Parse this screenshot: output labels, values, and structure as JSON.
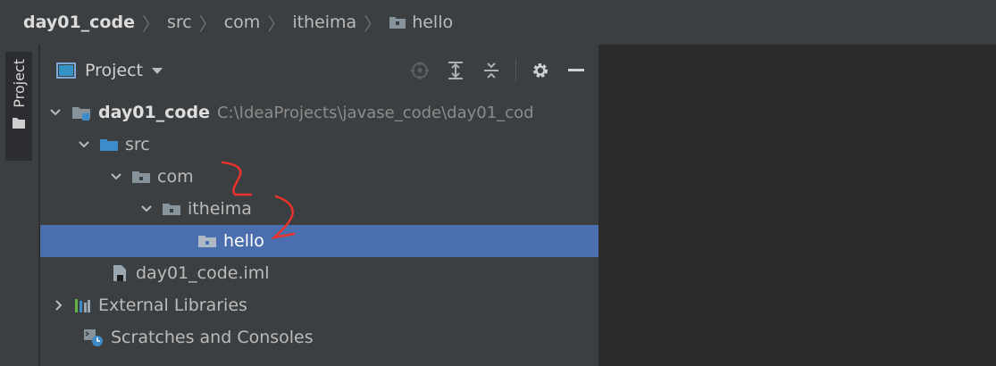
{
  "breadcrumb": {
    "items": [
      "day01_code",
      "src",
      "com",
      "itheima",
      "hello"
    ]
  },
  "toolstrip": {
    "project_tab_label": "Project"
  },
  "panel": {
    "title": "Project",
    "tools": [
      "locate-icon",
      "expand-all-icon",
      "collapse-all-icon",
      "gear-icon",
      "minimize-icon"
    ]
  },
  "tree": {
    "root_label": "day01_code",
    "root_path": "C:\\IdeaProjects\\javase_code\\day01_cod",
    "src_label": "src",
    "com_label": "com",
    "itheima_label": "itheima",
    "hello_label": "hello",
    "iml_label": "day01_code.iml",
    "ext_lib_label": "External Libraries",
    "scratches_label": "Scratches and Consoles"
  },
  "colors": {
    "selection": "#4b6eaf",
    "folder": "#87939a",
    "source_folder": "#3d8bc9",
    "annotation": "#e8322a"
  }
}
